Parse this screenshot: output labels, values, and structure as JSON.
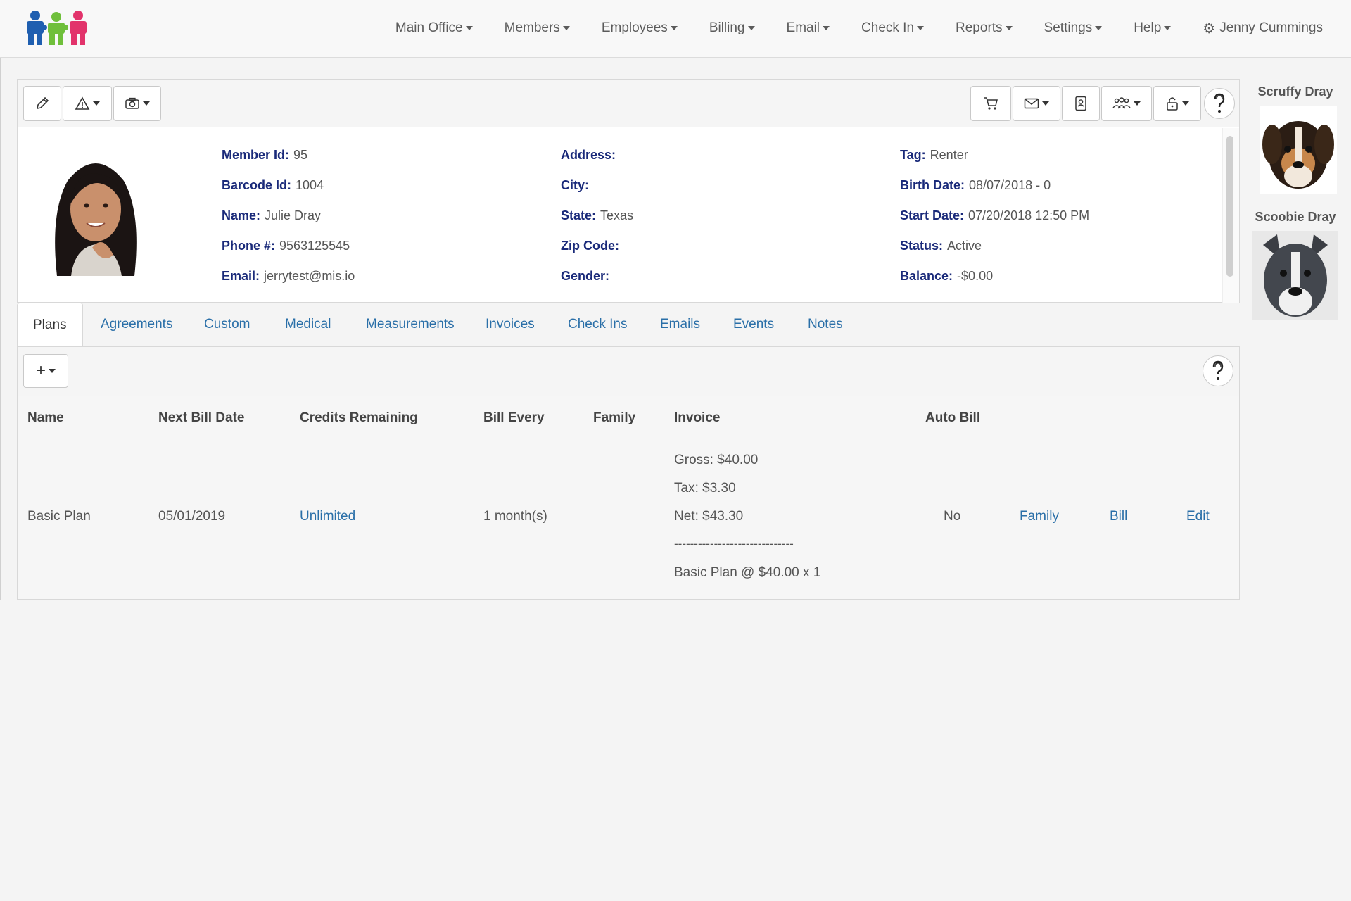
{
  "nav": {
    "items": [
      "Main Office",
      "Members",
      "Employees",
      "Billing",
      "Email",
      "Check In",
      "Reports",
      "Settings",
      "Help"
    ],
    "user": "Jenny Cummings"
  },
  "member": {
    "col1": [
      {
        "label": "Member Id:",
        "value": "95"
      },
      {
        "label": "Barcode Id:",
        "value": "1004"
      },
      {
        "label": "Name:",
        "value": "Julie Dray"
      },
      {
        "label": "Phone #:",
        "value": "9563125545"
      },
      {
        "label": "Email:",
        "value": "jerrytest@mis.io"
      }
    ],
    "col2": [
      {
        "label": "Address:",
        "value": ""
      },
      {
        "label": "City:",
        "value": ""
      },
      {
        "label": "State:",
        "value": "Texas"
      },
      {
        "label": "Zip Code:",
        "value": ""
      },
      {
        "label": "Gender:",
        "value": ""
      }
    ],
    "col3": [
      {
        "label": "Tag:",
        "value": "Renter"
      },
      {
        "label": "Birth Date:",
        "value": "08/07/2018 - 0"
      },
      {
        "label": "Start Date:",
        "value": "07/20/2018 12:50 PM"
      },
      {
        "label": "Status:",
        "value": "Active"
      },
      {
        "label": "Balance:",
        "value": "-$0.00"
      }
    ]
  },
  "pets": [
    {
      "name": "Scruffy Dray"
    },
    {
      "name": "Scoobie Dray"
    }
  ],
  "tabs": [
    "Plans",
    "Agreements",
    "Custom",
    "Medical",
    "Measurements",
    "Invoices",
    "Check Ins",
    "Emails",
    "Events",
    "Notes"
  ],
  "plans": {
    "add_label": "+",
    "headers": [
      "Name",
      "Next Bill Date",
      "Credits Remaining",
      "Bill Every",
      "Family",
      "Invoice",
      "Auto Bill"
    ],
    "row": {
      "name": "Basic Plan",
      "next_bill_date": "05/01/2019",
      "credits_remaining": "Unlimited",
      "bill_every": "1 month(s)",
      "invoice": {
        "gross": "Gross: $40.00",
        "tax": "Tax: $3.30",
        "net": "Net: $43.30",
        "divider": "------------------------------",
        "detail": "Basic Plan @ $40.00 x 1"
      },
      "auto_bill": "No",
      "actions": [
        "Family",
        "Bill",
        "Edit"
      ]
    }
  }
}
